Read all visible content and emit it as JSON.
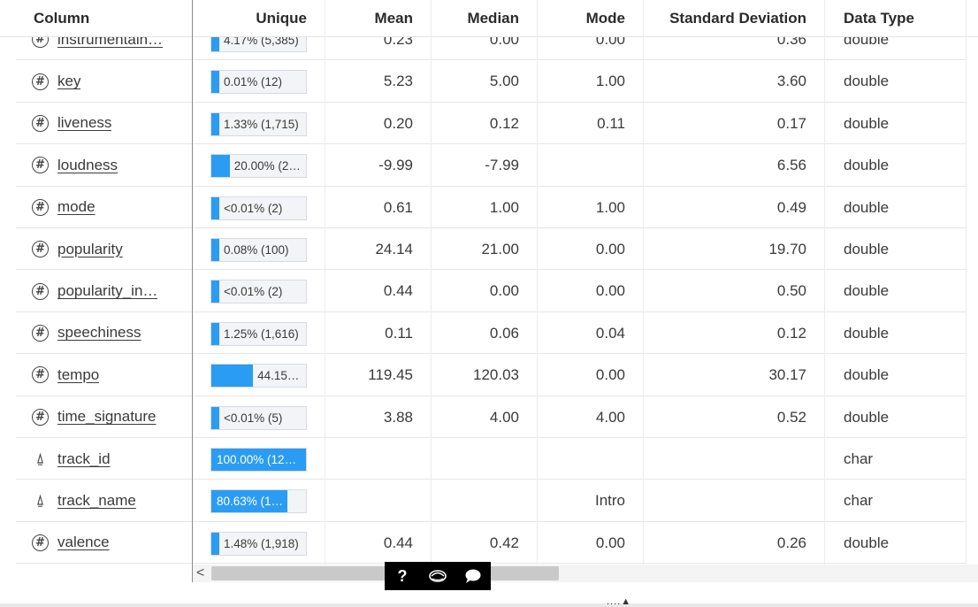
{
  "header": {
    "column": "Column",
    "unique": "Unique",
    "mean": "Mean",
    "median": "Median",
    "mode": "Mode",
    "std": "Standard Deviation",
    "dtype": "Data Type"
  },
  "rows": [
    {
      "name": "instrumentaln…",
      "icon": "numeric-icon",
      "unique": "4.17% (5,385)",
      "unique_fraction": 0.0417,
      "mean": "0.23",
      "median": "0.00",
      "mode": "0.00",
      "std": "0.36",
      "dtype": "double"
    },
    {
      "name": "key",
      "icon": "numeric-icon",
      "unique": "0.01% (12)",
      "unique_fraction": 0.0001,
      "mean": "5.23",
      "median": "5.00",
      "mode": "1.00",
      "std": "3.60",
      "dtype": "double"
    },
    {
      "name": "liveness",
      "icon": "numeric-icon",
      "unique": "1.33% (1,715)",
      "unique_fraction": 0.0133,
      "mean": "0.20",
      "median": "0.12",
      "mode": "0.11",
      "std": "0.17",
      "dtype": "double"
    },
    {
      "name": "loudness",
      "icon": "numeric-icon",
      "unique": "20.00% (25…",
      "unique_fraction": 0.2,
      "mean": "-9.99",
      "median": "-7.99",
      "mode": "",
      "std": "6.56",
      "dtype": "double"
    },
    {
      "name": "mode",
      "icon": "numeric-icon",
      "unique": "<0.01% (2)",
      "unique_fraction": 0.0,
      "mean": "0.61",
      "median": "1.00",
      "mode": "1.00",
      "std": "0.49",
      "dtype": "double"
    },
    {
      "name": "popularity",
      "icon": "numeric-icon",
      "unique": "0.08% (100)",
      "unique_fraction": 0.0008,
      "mean": "24.14",
      "median": "21.00",
      "mode": "0.00",
      "std": "19.70",
      "dtype": "double"
    },
    {
      "name": "popularity_in…",
      "icon": "numeric-icon",
      "unique": "<0.01% (2)",
      "unique_fraction": 0.0,
      "mean": "0.44",
      "median": "0.00",
      "mode": "0.00",
      "std": "0.50",
      "dtype": "double"
    },
    {
      "name": "speechiness",
      "icon": "numeric-icon",
      "unique": "1.25% (1,616)",
      "unique_fraction": 0.0125,
      "mean": "0.11",
      "median": "0.06",
      "mode": "0.04",
      "std": "0.12",
      "dtype": "double"
    },
    {
      "name": "tempo",
      "icon": "numeric-icon",
      "unique": "44.15…",
      "unique_fraction": 0.4415,
      "mean": "119.45",
      "median": "120.03",
      "mode": "0.00",
      "std": "30.17",
      "dtype": "double"
    },
    {
      "name": "time_signature",
      "icon": "numeric-icon",
      "unique": "<0.01% (5)",
      "unique_fraction": 0.0,
      "mean": "3.88",
      "median": "4.00",
      "mode": "4.00",
      "std": "0.52",
      "dtype": "double"
    },
    {
      "name": "track_id",
      "icon": "character-icon",
      "unique": "100.00% (129,…",
      "unique_fraction": 1.0,
      "mean": "",
      "median": "",
      "mode": "",
      "std": "",
      "dtype": "char"
    },
    {
      "name": "track_name",
      "icon": "character-icon",
      "unique": "80.63% (1…",
      "unique_fraction": 0.8063,
      "mean": "",
      "median": "",
      "mode": "Intro",
      "std": "",
      "dtype": "char"
    },
    {
      "name": "valence",
      "icon": "numeric-icon",
      "unique": "1.48% (1,918)",
      "unique_fraction": 0.0148,
      "mean": "0.44",
      "median": "0.42",
      "mode": "0.00",
      "std": "0.26",
      "dtype": "double"
    }
  ],
  "toolbar": {
    "help_label": "?",
    "chat_icon": "chat-bubble-icon",
    "logo_icon": "sas-logo-icon"
  },
  "scrollbar": {
    "left_arrow": "<"
  },
  "resize_handle": "....▲"
}
